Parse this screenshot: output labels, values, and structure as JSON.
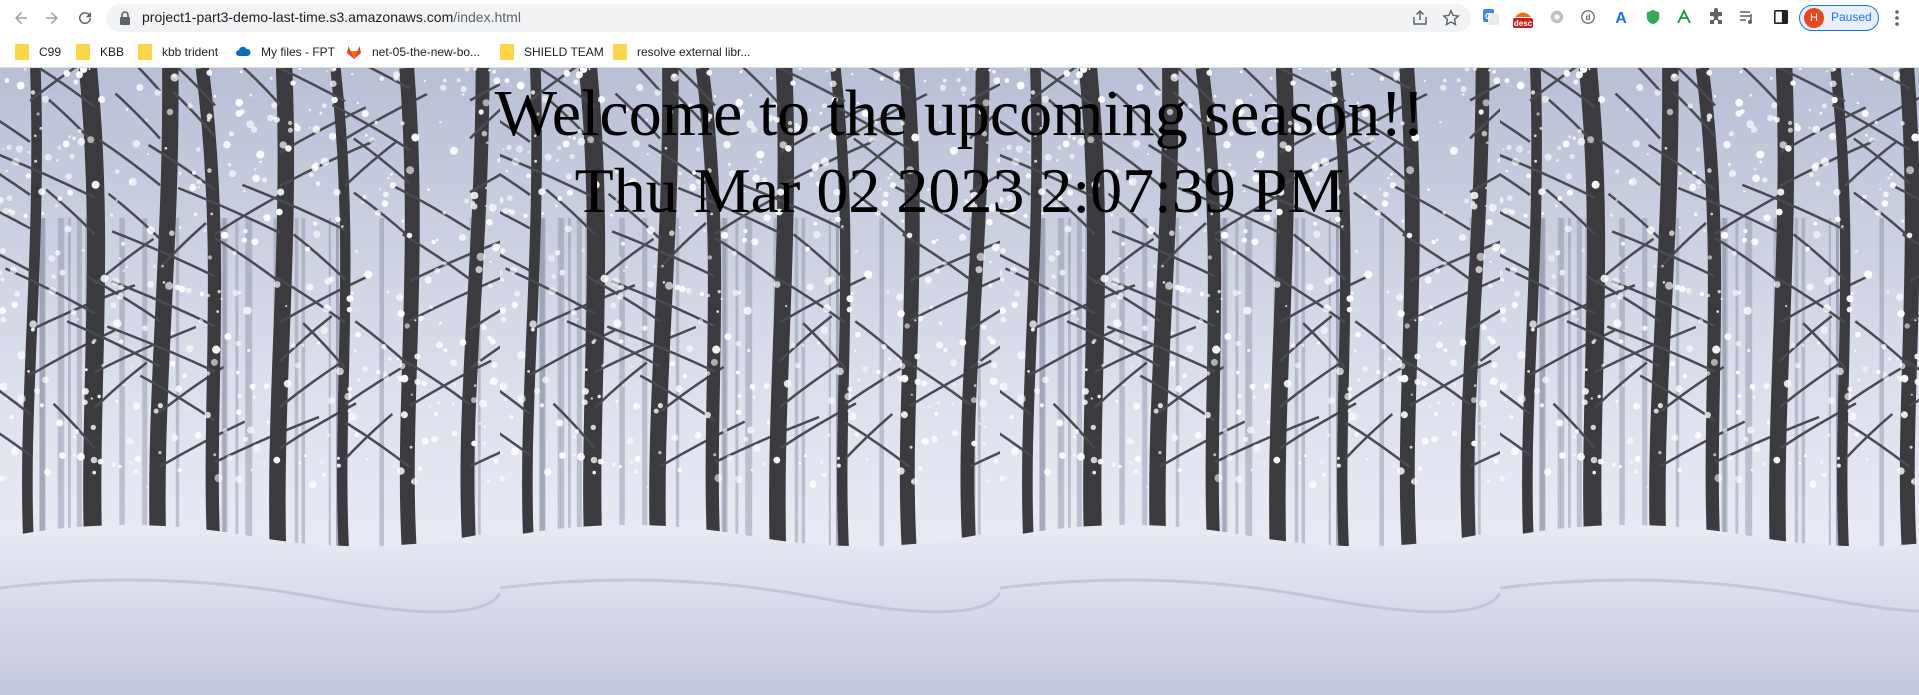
{
  "browser": {
    "url_host": "project1-part3-demo-last-time.s3.amazonaws.com",
    "url_path": "/index.html",
    "profile_initial": "H",
    "profile_status": "Paused",
    "extension_label": "desc"
  },
  "bookmarks": [
    {
      "label": "C99",
      "icon": "folder-icon"
    },
    {
      "label": "KBB",
      "icon": "folder-icon"
    },
    {
      "label": "kbb trident",
      "icon": "folder-icon"
    },
    {
      "label": "My files - FPT",
      "icon": "onedrive-icon"
    },
    {
      "label": "net-05-the-new-bo...",
      "icon": "gitlab-icon"
    },
    {
      "label": "SHIELD TEAM",
      "icon": "folder-icon"
    },
    {
      "label": "resolve external libr...",
      "icon": "folder-icon"
    }
  ],
  "page": {
    "welcome": "Welcome to the upcoming season!!",
    "datetime": "Thu Mar 02 2023 2:07:39 PM"
  },
  "colors": {
    "accent": "#1a73e8",
    "folder": "#fbd64a",
    "snow_sky": "#c9cfe3"
  }
}
